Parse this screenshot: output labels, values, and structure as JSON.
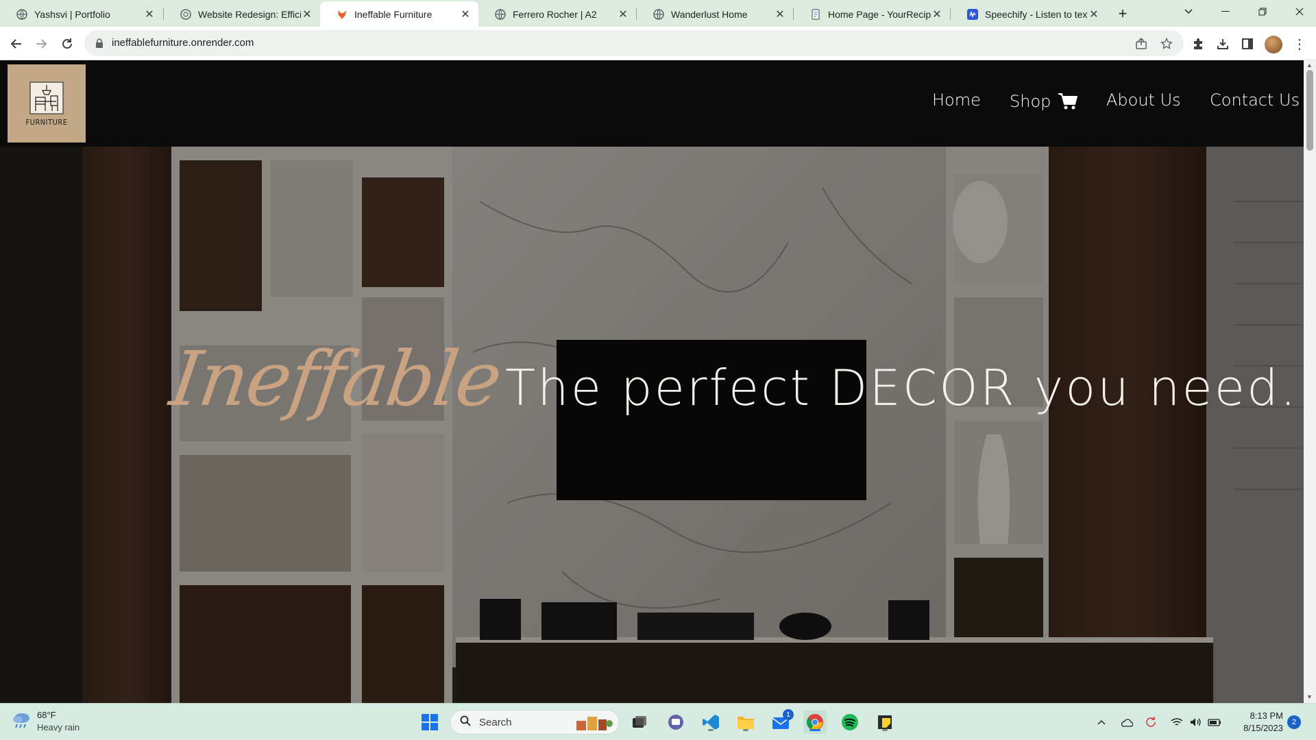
{
  "browser": {
    "tabs": [
      {
        "title": "Yashsvi | Portfolio",
        "icon": "globe-icon",
        "active": false
      },
      {
        "title": "Website Redesign: Efficier",
        "icon": "chatgpt-icon",
        "active": false
      },
      {
        "title": "Ineffable Furniture",
        "icon": "fox-icon",
        "active": true
      },
      {
        "title": "Ferrero Rocher | A2",
        "icon": "globe-icon",
        "active": false
      },
      {
        "title": "Wanderlust Home",
        "icon": "globe-icon",
        "active": false
      },
      {
        "title": "Home Page - YourRecipe",
        "icon": "document-icon",
        "active": false
      },
      {
        "title": "Speechify - Listen to text",
        "icon": "speechify-icon",
        "active": false
      }
    ],
    "url": "ineffablefurniture.onrender.com"
  },
  "site": {
    "logo_text": "FURNITURE",
    "nav": {
      "home": "Home",
      "shop": "Shop",
      "about": "About Us",
      "contact": "Contact Us"
    },
    "hero": {
      "script_word": "Ineffable",
      "tagline": "The perfect DECOR you need."
    },
    "colors": {
      "header_bg": "#0b0b0b",
      "logo_bg": "#c2a886",
      "script_accent": "#c8a281",
      "nav_text": "#ffffff"
    }
  },
  "taskbar": {
    "weather": {
      "temp": "68°F",
      "condition": "Heavy rain"
    },
    "search_placeholder": "Search",
    "mail_badge": "1",
    "clock": {
      "time": "8:13 PM",
      "date": "8/15/2023"
    },
    "notification_count": "2"
  }
}
